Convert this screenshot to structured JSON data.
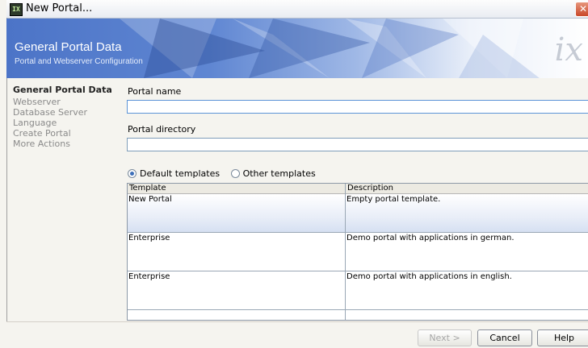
{
  "window": {
    "title": "New Portal...",
    "app_icon": "IX",
    "close": "✕"
  },
  "banner": {
    "title": "General Portal Data",
    "subtitle": "Portal and Webserver Configuration",
    "logo": "ix"
  },
  "steps": [
    {
      "label": "General Portal Data",
      "active": true
    },
    {
      "label": "Webserver",
      "active": false
    },
    {
      "label": "Database Server",
      "active": false
    },
    {
      "label": "Language",
      "active": false
    },
    {
      "label": "Create Portal",
      "active": false
    },
    {
      "label": "More Actions",
      "active": false
    }
  ],
  "form": {
    "portal_name_label": "Portal name",
    "portal_name_value": "",
    "portal_directory_label": "Portal directory",
    "portal_directory_value": ""
  },
  "templates": {
    "radio_default": "Default templates",
    "radio_other": "Other templates",
    "selected": "default",
    "columns": [
      "Template",
      "Description"
    ],
    "rows": [
      {
        "template": "New Portal",
        "description": "Empty portal template.",
        "selected": true
      },
      {
        "template": "Enterprise",
        "description": "Demo portal with applications in german.",
        "selected": false
      },
      {
        "template": "Enterprise",
        "description": "Demo portal with applications in english.",
        "selected": false
      }
    ]
  },
  "buttons": {
    "next": "Next >",
    "cancel": "Cancel",
    "help": "Help"
  }
}
